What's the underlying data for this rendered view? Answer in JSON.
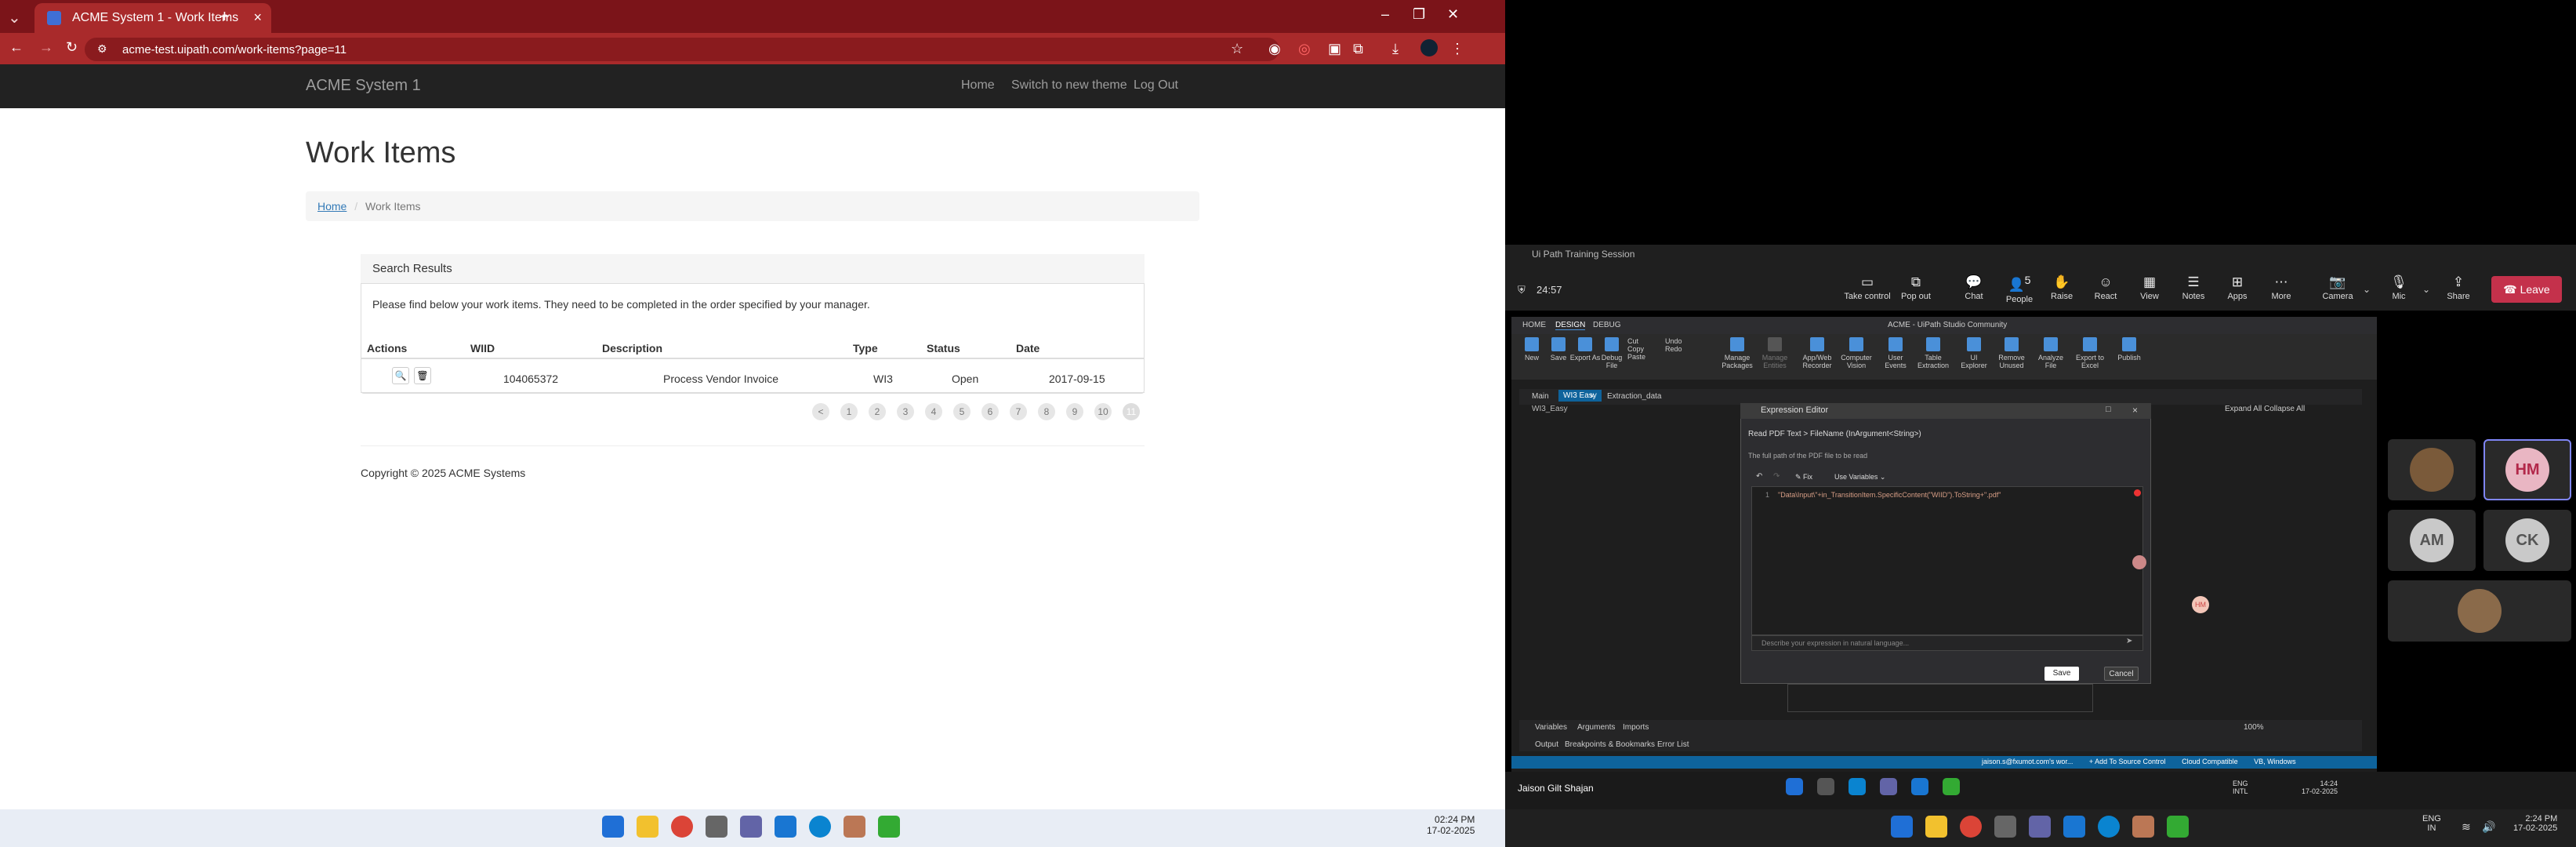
{
  "browser": {
    "tab_title": "ACME System 1 - Work Items",
    "url": "acme-test.uipath.com/work-items?page=11",
    "new_tab": "+"
  },
  "site": {
    "brand": "ACME System 1",
    "nav": [
      "Home",
      "Switch to new theme",
      "Log Out"
    ],
    "page_title": "Work Items",
    "breadcrumb": {
      "home": "Home",
      "sep": "/",
      "current": "Work Items"
    },
    "panel_title": "Search Results",
    "panel_text": "Please find below your work items. They need to be completed in the order specified by your manager.",
    "columns": [
      "Actions",
      "WIID",
      "Description",
      "Type",
      "Status",
      "Date"
    ],
    "rows": [
      {
        "wiid": "104065372",
        "description": "Process Vendor Invoice",
        "type": "WI3",
        "status": "Open",
        "date": "2017-09-15"
      }
    ],
    "pagination": [
      "<",
      "1",
      "2",
      "3",
      "4",
      "5",
      "6",
      "7",
      "8",
      "9",
      "10",
      "11"
    ],
    "copyright": "Copyright © 2025 ACME Systems"
  },
  "left_clock": {
    "time": "02:24 PM",
    "date": "17-02-2025"
  },
  "teams": {
    "window_title": "Ui Path Training Session",
    "timer": "24:57",
    "toolbar": [
      {
        "label": "Take control",
        "icon": "monitor-icon"
      },
      {
        "label": "Pop out",
        "icon": "popout-icon"
      },
      {
        "label": "Chat",
        "icon": "chat-icon"
      },
      {
        "label": "People",
        "icon": "people-icon"
      },
      {
        "label": "Raise",
        "icon": "hand-icon"
      },
      {
        "label": "React",
        "icon": "smile-icon"
      },
      {
        "label": "View",
        "icon": "grid-icon"
      },
      {
        "label": "Notes",
        "icon": "notes-icon"
      },
      {
        "label": "Apps",
        "icon": "apps-icon"
      },
      {
        "label": "More",
        "icon": "more-icon"
      },
      {
        "label": "Camera",
        "icon": "camera-icon"
      },
      {
        "label": "Mic",
        "icon": "mic-icon"
      },
      {
        "label": "Share",
        "icon": "share-icon"
      }
    ],
    "people_count": "5",
    "leave": "Leave",
    "participants": [
      "HM",
      "AM",
      "CK"
    ],
    "presenter": "Jaison Gilt Shajan"
  },
  "studio": {
    "tabs": [
      "HOME",
      "DESIGN",
      "DEBUG"
    ],
    "title": "ACME - UiPath Studio Community",
    "ribbon": [
      "New",
      "Save",
      "Export As",
      "Debug File",
      "Cut",
      "Copy",
      "Paste",
      "Undo",
      "Redo",
      "Manage Packages",
      "Manage Entities",
      "App/Web Recorder",
      "Computer Vision",
      "User Events",
      "Table Extraction",
      "UI Explorer",
      "Remove Unused",
      "Analyze File",
      "Export to Excel",
      "Publish"
    ],
    "doc_tabs": [
      "Main",
      "WI3 Easy",
      "Extraction_data"
    ],
    "breadcrumb": "WI3_Easy",
    "expand_all": "Expand All",
    "collapse_all": "Collapse All",
    "expr_title": "Expression Editor",
    "expr_path": "Read PDF Text > FileName (InArgument<String>)",
    "expr_desc": "The full path of the PDF file to be read",
    "fix": "Fix",
    "use_variables": "Use Variables",
    "code": "\"Data\\Input\\\"+in_TransitionItem.SpecificContent(\"WIID\").ToString+\".pdf\"",
    "nl_placeholder": "Describe your expression in natural language...",
    "save": "Save",
    "cancel": "Cancel",
    "bottom_tabs": [
      "Variables",
      "Arguments",
      "Imports"
    ],
    "output_tabs": [
      "Output",
      "Breakpoints & Bookmarks",
      "Error List"
    ],
    "zoom": "100%",
    "status": [
      "jaison.s@fxumot.com's wor...",
      "+ Add To Source Control",
      "Cloud Compatible",
      "VB, Windows"
    ]
  },
  "right_clock": {
    "time": "2:24 PM",
    "date": "17-02-2025",
    "lang": "ENG",
    "region": "IN"
  },
  "inner_clock": {
    "time": "14:24",
    "date": "17-02-2025",
    "lang": "ENG",
    "region": "INTL"
  }
}
